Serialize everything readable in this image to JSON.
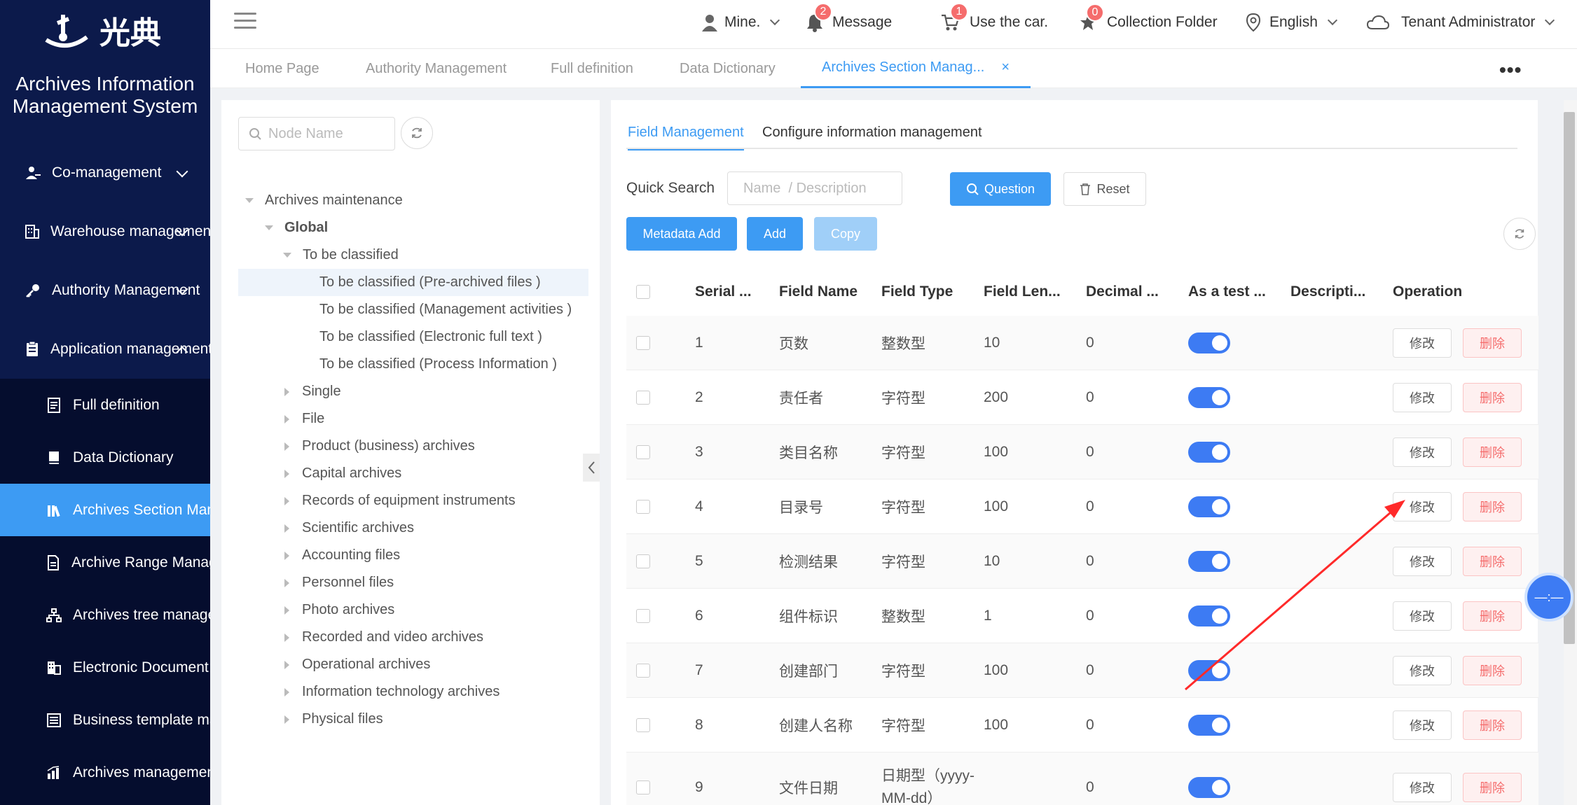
{
  "app": {
    "logo_text": "光典",
    "title_line1": "Archives Information",
    "title_line2": "Management System"
  },
  "sidebar": {
    "menu": [
      {
        "label": "Co-management",
        "icon": "user-group-icon"
      },
      {
        "label": "Warehouse management",
        "icon": "building-icon"
      },
      {
        "label": "Authority Management",
        "icon": "key-icon"
      },
      {
        "label": "Application management",
        "icon": "clipboard-icon"
      }
    ],
    "submenu": [
      {
        "label": "Full definition",
        "icon": "document-icon"
      },
      {
        "label": "Data Dictionary",
        "icon": "book-icon"
      },
      {
        "label": "Archives Section Management",
        "icon": "library-icon"
      },
      {
        "label": "Archive Range Management",
        "icon": "file-icon"
      },
      {
        "label": "Archives tree management",
        "icon": "tree-icon"
      },
      {
        "label": "Electronic Document",
        "icon": "office-icon"
      },
      {
        "label": "Business template management",
        "icon": "template-icon"
      },
      {
        "label": "Archives management",
        "icon": "chart-icon"
      }
    ]
  },
  "header": {
    "user": "Mine.",
    "message": "Message",
    "message_count": "2",
    "cart": "Use the car.",
    "cart_count": "1",
    "collection": "Collection Folder",
    "collection_count": "0",
    "language": "English",
    "tenant": "Tenant Administrator"
  },
  "tabs": [
    {
      "label": "Home Page"
    },
    {
      "label": "Authority Management"
    },
    {
      "label": "Full definition"
    },
    {
      "label": "Data Dictionary"
    },
    {
      "label": "Archives Section Manag..."
    }
  ],
  "tree": {
    "search_placeholder": "Node Name",
    "nodes": [
      "Archives maintenance",
      "Global",
      "To be classified",
      "To be classified (Pre-archived files )",
      "To be classified (Management activities )",
      "To be classified (Electronic full text )",
      "To be classified (Process Information )",
      "Single",
      "File",
      "Product (business) archives",
      "Capital archives",
      "Records of equipment instruments",
      "Scientific archives",
      "Accounting files",
      "Personnel files",
      "Photo archives",
      "Recorded and video archives",
      "Operational archives",
      "Information technology archives",
      "Physical files"
    ]
  },
  "main": {
    "inner_tabs": [
      "Field Management",
      "Configure information management"
    ],
    "quick_search_label": "Quick Search",
    "quick_search_placeholder": "Name  / Description",
    "btn_question": "Question",
    "btn_reset": "Reset",
    "btn_metadata_add": "Metadata Add",
    "btn_add": "Add",
    "btn_copy": "Copy",
    "columns": [
      "Serial ...",
      "Field Name",
      "Field Type",
      "Field Len...",
      "Decimal ...",
      "As a test ...",
      "Descripti...",
      "Operation"
    ],
    "edit_label": "修改",
    "delete_label": "删除",
    "rows": [
      {
        "serial": "1",
        "name": "页数",
        "type": "整数型",
        "length": "10",
        "decimal": "0"
      },
      {
        "serial": "2",
        "name": "责任者",
        "type": "字符型",
        "length": "200",
        "decimal": "0"
      },
      {
        "serial": "3",
        "name": "类目名称",
        "type": "字符型",
        "length": "100",
        "decimal": "0"
      },
      {
        "serial": "4",
        "name": "目录号",
        "type": "字符型",
        "length": "100",
        "decimal": "0"
      },
      {
        "serial": "5",
        "name": "检测结果",
        "type": "字符型",
        "length": "10",
        "decimal": "0"
      },
      {
        "serial": "6",
        "name": "组件标识",
        "type": "整数型",
        "length": "1",
        "decimal": "0"
      },
      {
        "serial": "7",
        "name": "创建部门",
        "type": "字符型",
        "length": "100",
        "decimal": "0"
      },
      {
        "serial": "8",
        "name": "创建人名称",
        "type": "字符型",
        "length": "100",
        "decimal": "0"
      },
      {
        "serial": "9",
        "name": "文件日期",
        "type": "日期型（yyyy-MM-dd）",
        "length": "",
        "decimal": "0"
      }
    ]
  },
  "colors": {
    "sidebar_bg": "#0c1a4b",
    "accent": "#3d9bf3",
    "danger": "#f56c6c",
    "annotation_arrow": "#ff2a2a"
  }
}
